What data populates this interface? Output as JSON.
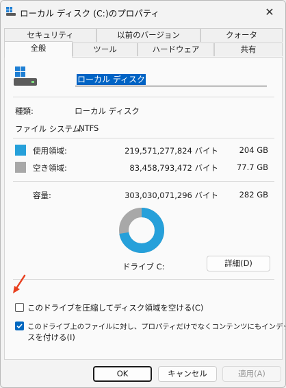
{
  "window": {
    "title": "ローカル ディスク (C:)のプロパティ",
    "close_glyph": "✕"
  },
  "tabs_row1": [
    {
      "label": "セキュリティ"
    },
    {
      "label": "以前のバージョン"
    },
    {
      "label": "クォータ"
    }
  ],
  "tabs_row2": [
    {
      "label": "全般",
      "active": true
    },
    {
      "label": "ツール"
    },
    {
      "label": "ハードウェア"
    },
    {
      "label": "共有"
    }
  ],
  "general": {
    "drive_name_value": "ローカル ディスク",
    "type_label": "種類:",
    "type_value": "ローカル ディスク",
    "fs_label": "ファイル システム:",
    "fs_value": "NTFS",
    "used_label": "使用領域:",
    "used_bytes": "219,571,277,824 バイト",
    "used_gb": "204 GB",
    "free_label": "空き領域:",
    "free_bytes": "83,458,793,472 バイト",
    "free_gb": "77.7 GB",
    "capacity_label": "容量:",
    "capacity_bytes": "303,030,071,296 バイト",
    "capacity_gb": "282 GB",
    "drive_label": "ドライブ C:",
    "details_button": "詳細(D)",
    "compress_label": "このドライブを圧縮してディスク領域を空ける(C)",
    "compress_checked": false,
    "index_label_line1": "このドライブ上のファイルに対し、プロパティだけでなくコンテンツにもインデックス",
    "index_label_line2": "スを付ける(I)",
    "index_checked": true
  },
  "colors": {
    "used": "#26a0da",
    "free": "#a8a8a8",
    "accent": "#0067c0",
    "highlight": "#e8401f"
  },
  "footer": {
    "ok": "OK",
    "cancel": "キャンセル",
    "apply": "適用(A)"
  }
}
